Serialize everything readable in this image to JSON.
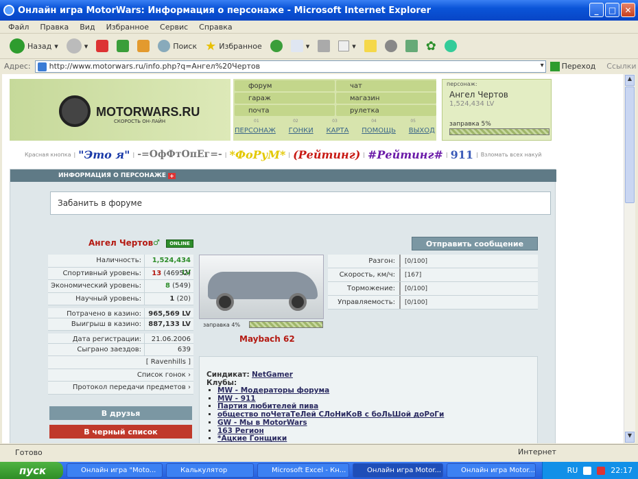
{
  "window": {
    "title": "Онлайн игра MotorWars: Информация о персонаже - Microsoft Internet Explorer"
  },
  "menubar": [
    "Файл",
    "Правка",
    "Вид",
    "Избранное",
    "Сервис",
    "Справка"
  ],
  "toolbar": {
    "back": "Назад",
    "search": "Поиск",
    "favorites": "Избранное"
  },
  "address": {
    "label": "Адрес:",
    "url": "http://www.motorwars.ru/info.php?q=Ангел%20Чертов",
    "go": "Переход",
    "links": "Ссылки"
  },
  "site": {
    "logo": "MOTORWARS.RU",
    "slogan": "СКОРОСТЬ ОН-ЛАЙН",
    "menu": [
      "форум",
      "чат",
      "гараж",
      "магазин",
      "почта",
      "рулетка"
    ],
    "subnav": [
      "ПЕРСОНАЖ",
      "ГОНКИ",
      "КАРТА",
      "ПОМОЩЬ",
      "ВЫХОД"
    ],
    "ticks": [
      "01",
      "02",
      "03",
      "04",
      "05"
    ],
    "persona_label": "персонаж:",
    "persona_name": "Ангел Чертов",
    "persona_level": "1,524,434 LV",
    "persona_fuel": "заправка 5%"
  },
  "links": {
    "first": "Красная кнопка",
    "l1": "\"Это я\"",
    "l2": "-=ОфФтОпЕг=-",
    "l3": "*ФоРуМ*",
    "l4": "(Рейтинг)",
    "l5": "#Рейтинг#",
    "l6": "911",
    "last": "Взломать всех накуй"
  },
  "panel": {
    "header": "ИНФОРМАЦИЯ О ПЕРСОНАЖЕ",
    "ban": "Забанить в форуме",
    "name": "Ангел Чертов",
    "online": "ONLINE",
    "send": "Отправить сообщение"
  },
  "stats": [
    {
      "k": "Наличность:",
      "v": "1,524,434 LV"
    },
    {
      "k": "Спортивный уровень:",
      "v": "13",
      "s": "(46952)"
    },
    {
      "k": "Экономический уровень:",
      "v": "8",
      "s": "(549)"
    },
    {
      "k": "Научный уровень:",
      "v": "1",
      "s": "(20)"
    },
    {
      "k": "Потрачено в казино:",
      "v": "965,569 LV"
    },
    {
      "k": "Выигрыш в казино:",
      "v": "887,133 LV"
    },
    {
      "k": "Дата регистрации:",
      "v": "21.06.2006"
    },
    {
      "k": "Сыграно заездов:",
      "v": "639"
    }
  ],
  "extra_links": [
    "[ Ravenhills ]",
    "Список гонок",
    "Протокол передачи предметов"
  ],
  "buttons": {
    "friends": "В друзья",
    "blacklist": "В черный список"
  },
  "car": {
    "fuel": "заправка 4%",
    "name": "Maybach 62"
  },
  "specs": [
    {
      "k": "Разгон:",
      "v": "[0/100]"
    },
    {
      "k": "Скорость, км/ч:",
      "v": "[167]"
    },
    {
      "k": "Торможение:",
      "v": "[0/100]"
    },
    {
      "k": "Управляемость:",
      "v": "[0/100]"
    }
  ],
  "syndicate": {
    "label": "Синдикат:",
    "name": "NetGamer",
    "clubs_label": "Клубы:",
    "clubs": [
      "MW - Модераторы форума",
      "MW - 911",
      "Партия любителей пива",
      "общество поЧетаТеЛей СЛоНиКоВ с боЛьШой доРоГи",
      "GW - Мы в MotorWars",
      "163 Регион",
      "*Ацкие Гонщики"
    ]
  },
  "status": {
    "text": "Готово",
    "zone": "Интернет"
  },
  "taskbar": {
    "start": "пуск",
    "tasks": [
      "Онлайн игра \"Moto...",
      "Калькулятор",
      "Microsoft Excel - Кн...",
      "Онлайн игра Motor...",
      "Онлайн игра Motor..."
    ],
    "lang": "RU",
    "clock": "22:17"
  },
  "colors": {
    "accent": "#b41a12",
    "header": "#5f7a86",
    "online": "#2e8d2b",
    "blacklist": "#c0392b",
    "friends": "#7b97a3"
  }
}
